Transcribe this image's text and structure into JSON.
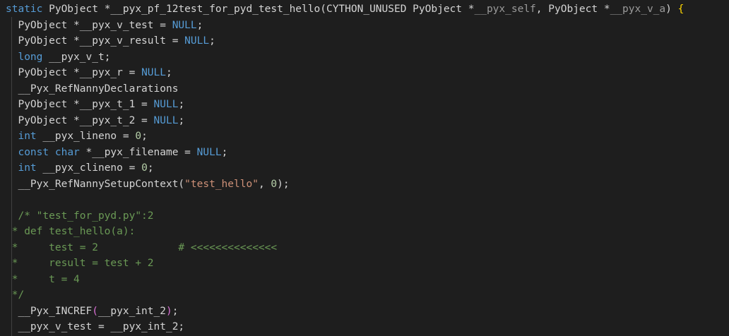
{
  "editor": {
    "language": "C (Cython generated)",
    "colors": {
      "background": "#1e1e1e",
      "keyword": "#569cd6",
      "comment": "#6a9955",
      "number": "#b5cea8",
      "string": "#ce9178",
      "text": "#d4d4d4",
      "brace": "#ffd700"
    },
    "lines": [
      [
        {
          "t": "static",
          "c": "kw"
        },
        {
          "t": " PyObject *__pyx_pf_12test_for_pyd_test_hello(CYTHON_UNUSED PyObject *",
          "c": "plain"
        },
        {
          "t": "__pyx_self",
          "c": "dim"
        },
        {
          "t": ", PyObject *",
          "c": "plain"
        },
        {
          "t": "__pyx_v_a",
          "c": "dim"
        },
        {
          "t": ") ",
          "c": "plain"
        },
        {
          "t": "{",
          "c": "brace"
        }
      ],
      [
        {
          "t": "  PyObject *__pyx_v_test = ",
          "c": "plain"
        },
        {
          "t": "NULL",
          "c": "kw"
        },
        {
          "t": ";",
          "c": "plain"
        }
      ],
      [
        {
          "t": "  PyObject *__pyx_v_result = ",
          "c": "plain"
        },
        {
          "t": "NULL",
          "c": "kw"
        },
        {
          "t": ";",
          "c": "plain"
        }
      ],
      [
        {
          "t": "  ",
          "c": "plain"
        },
        {
          "t": "long",
          "c": "kw"
        },
        {
          "t": " __pyx_v_t;",
          "c": "plain"
        }
      ],
      [
        {
          "t": "  PyObject *__pyx_r = ",
          "c": "plain"
        },
        {
          "t": "NULL",
          "c": "kw"
        },
        {
          "t": ";",
          "c": "plain"
        }
      ],
      [
        {
          "t": "  __Pyx_RefNannyDeclarations",
          "c": "plain"
        }
      ],
      [
        {
          "t": "  PyObject *__pyx_t_1 = ",
          "c": "plain"
        },
        {
          "t": "NULL",
          "c": "kw"
        },
        {
          "t": ";",
          "c": "plain"
        }
      ],
      [
        {
          "t": "  PyObject *__pyx_t_2 = ",
          "c": "plain"
        },
        {
          "t": "NULL",
          "c": "kw"
        },
        {
          "t": ";",
          "c": "plain"
        }
      ],
      [
        {
          "t": "  ",
          "c": "plain"
        },
        {
          "t": "int",
          "c": "kw"
        },
        {
          "t": " __pyx_lineno = ",
          "c": "plain"
        },
        {
          "t": "0",
          "c": "num"
        },
        {
          "t": ";",
          "c": "plain"
        }
      ],
      [
        {
          "t": "  ",
          "c": "plain"
        },
        {
          "t": "const",
          "c": "kw"
        },
        {
          "t": " ",
          "c": "plain"
        },
        {
          "t": "char",
          "c": "kw"
        },
        {
          "t": " *__pyx_filename = ",
          "c": "plain"
        },
        {
          "t": "NULL",
          "c": "kw"
        },
        {
          "t": ";",
          "c": "plain"
        }
      ],
      [
        {
          "t": "  ",
          "c": "plain"
        },
        {
          "t": "int",
          "c": "kw"
        },
        {
          "t": " __pyx_clineno = ",
          "c": "plain"
        },
        {
          "t": "0",
          "c": "num"
        },
        {
          "t": ";",
          "c": "plain"
        }
      ],
      [
        {
          "t": "  __Pyx_RefNannySetupContext(",
          "c": "plain"
        },
        {
          "t": "\"test_hello\"",
          "c": "str"
        },
        {
          "t": ", ",
          "c": "plain"
        },
        {
          "t": "0",
          "c": "num"
        },
        {
          "t": ");",
          "c": "plain"
        }
      ],
      [],
      [
        {
          "t": "  /* \"test_for_pyd.py\":2",
          "c": "cm"
        }
      ],
      [
        {
          "t": " * def test_hello(a):",
          "c": "cm"
        }
      ],
      [
        {
          "t": " *     test = 2             # <<<<<<<<<<<<<<",
          "c": "cm"
        }
      ],
      [
        {
          "t": " *     result = test + 2",
          "c": "cm"
        }
      ],
      [
        {
          "t": " *     t = 4",
          "c": "cm"
        }
      ],
      [
        {
          "t": " */",
          "c": "cm"
        }
      ],
      [
        {
          "t": "  __Pyx_INCREF",
          "c": "plain"
        },
        {
          "t": "(",
          "c": "paren"
        },
        {
          "t": "__pyx_int_2",
          "c": "plain"
        },
        {
          "t": ")",
          "c": "paren"
        },
        {
          "t": ";",
          "c": "plain"
        }
      ],
      [
        {
          "t": "  __pyx_v_test = __pyx_int_2;",
          "c": "plain"
        }
      ]
    ]
  }
}
